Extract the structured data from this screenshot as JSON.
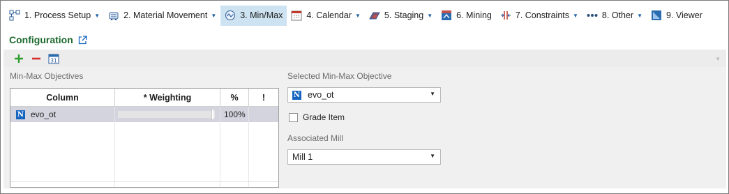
{
  "tabs": [
    {
      "label": "1. Process Setup",
      "icon": "process-setup-icon",
      "dropdown": true,
      "active": false
    },
    {
      "label": "2. Material Movement",
      "icon": "material-movement-icon",
      "dropdown": true,
      "active": false
    },
    {
      "label": "3. Min/Max",
      "icon": "minmax-icon",
      "dropdown": false,
      "active": true
    },
    {
      "label": "4. Calendar",
      "icon": "calendar-icon",
      "dropdown": true,
      "active": false
    },
    {
      "label": "5. Staging",
      "icon": "staging-icon",
      "dropdown": true,
      "active": false
    },
    {
      "label": "6. Mining",
      "icon": "mining-icon",
      "dropdown": false,
      "active": false
    },
    {
      "label": "7. Constraints",
      "icon": "constraints-icon",
      "dropdown": true,
      "active": false
    },
    {
      "label": "8. Other",
      "icon": "more-dots-icon",
      "dropdown": true,
      "active": false
    },
    {
      "label": "9. Viewer",
      "icon": "viewer-icon",
      "dropdown": false,
      "active": false
    }
  ],
  "configuration": {
    "title": "Configuration"
  },
  "toolbar": {
    "add_icon": "plus-icon",
    "remove_icon": "minus-icon",
    "calendar_icon": "calendar-31-icon",
    "calendar_day": "31"
  },
  "objectives": {
    "section_label": "Min-Max Objectives",
    "columns": {
      "column": "Column",
      "weighting": "* Weighting",
      "percent": "%",
      "flag": "!"
    },
    "rows": [
      {
        "badge": "N",
        "name": "evo_ot",
        "weighting_fraction": 1.0,
        "percent": "100%",
        "flag": ""
      }
    ]
  },
  "selected": {
    "section_label": "Selected Min-Max Objective",
    "objective_badge": "N",
    "objective_value": "evo_ot",
    "grade_item_label": "Grade Item",
    "grade_item_checked": false,
    "mill_label": "Associated Mill",
    "mill_value": "Mill 1"
  },
  "colors": {
    "accent_active_tab": "#cde3f1",
    "title_green": "#1d6a2e",
    "badge_blue": "#1565c0",
    "selected_row": "#d3d4de"
  }
}
